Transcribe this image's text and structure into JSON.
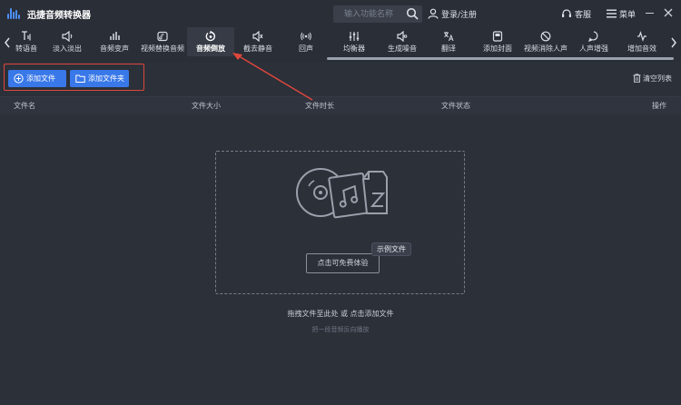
{
  "app": {
    "title": "迅捷音频转换器"
  },
  "header": {
    "search_placeholder": "输入功能名称",
    "login_label": "登录/注册",
    "support_label": "客服",
    "menu_label": "菜单"
  },
  "toolbar": {
    "items": [
      {
        "label": "转语音",
        "icon": "text-to-speech-icon"
      },
      {
        "label": "淡入淡出",
        "icon": "fade-icon"
      },
      {
        "label": "音频变声",
        "icon": "voice-change-icon"
      },
      {
        "label": "视频替换音频",
        "icon": "video-replace-audio-icon"
      },
      {
        "label": "音频倒放",
        "icon": "reverse-audio-icon",
        "active": true
      },
      {
        "label": "截去静音",
        "icon": "trim-silence-icon"
      },
      {
        "label": "回声",
        "icon": "echo-icon"
      },
      {
        "label": "均衡器",
        "icon": "equalizer-icon"
      },
      {
        "label": "生成噪音",
        "icon": "noise-icon"
      },
      {
        "label": "翻译",
        "icon": "translate-icon"
      },
      {
        "label": "添加封面",
        "icon": "add-cover-icon"
      },
      {
        "label": "视频消除人声",
        "icon": "remove-vocals-icon"
      },
      {
        "label": "人声增强",
        "icon": "vocal-enhance-icon"
      },
      {
        "label": "增加音效",
        "icon": "add-effect-icon"
      }
    ]
  },
  "actions": {
    "add_file_label": "添加文件",
    "add_folder_label": "添加文件夹",
    "clear_list_label": "清空列表"
  },
  "table": {
    "columns": [
      "文件名",
      "文件大小",
      "文件时长",
      "文件状态",
      "操作"
    ]
  },
  "dropzone": {
    "try_label": "点击可免费体验",
    "sample_tag": "示例文件",
    "hint": "拖拽文件至此处 或 点击添加文件",
    "subhint": "把一段音频反向播放"
  },
  "colors": {
    "accent": "#3978e8",
    "annotation": "#e0473c",
    "background": "#2c3039"
  }
}
